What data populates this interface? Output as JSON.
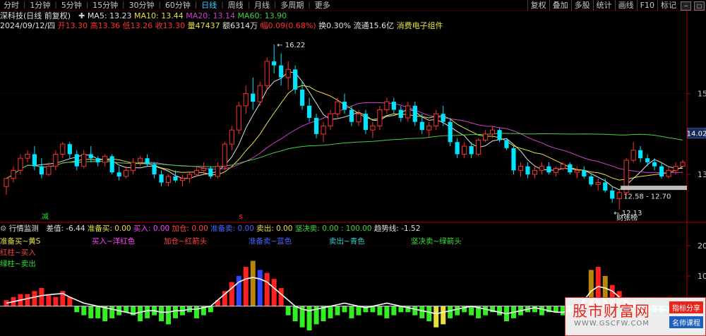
{
  "toolbar": {
    "tabs": [
      "分时",
      "1分钟",
      "5分钟",
      "15分钟",
      "30分钟",
      "60分钟",
      "日线",
      "周线",
      "月线",
      "多周期",
      "更多"
    ],
    "active_tab": 6,
    "right_tabs": [
      "复权",
      "叠加",
      "多股",
      "统计",
      "画线",
      "F10",
      "标记"
    ]
  },
  "header": {
    "stock_name": "深科技(日线 前复权)",
    "ma": [
      {
        "label": "MA5: 13.23",
        "color": "#e0e0e0"
      },
      {
        "label": "MA10: 13.44",
        "color": "#e8e040"
      },
      {
        "label": "MA20: 13.14",
        "color": "#d040d0"
      },
      {
        "label": "MA60: 13.90",
        "color": "#40d040"
      }
    ],
    "quote": {
      "date": "2024/09/12/四",
      "open_label": "开",
      "open": "13.30",
      "high_label": "高",
      "high": "13.36",
      "low_label": "低",
      "low": "13.26",
      "close_label": "收",
      "close": "13.30",
      "vol_label": "量",
      "vol": "47437",
      "amt_label": "额",
      "amt": "6314万",
      "chg_label": "幅",
      "chg": "0.09(0.68%)",
      "turn": "换0.30%",
      "float": "流通15.6亿",
      "concept": "消费电子组件"
    }
  },
  "indicator": {
    "name": "行情监测",
    "stats": [
      {
        "label": "差值: -6.44",
        "color": "#e0e0e0"
      },
      {
        "label": "准备买: 0.00",
        "color": "#e8e040"
      },
      {
        "label": "买入: 0.00",
        "color": "#ff44ff"
      },
      {
        "label": "加仓: 0.00",
        "color": "#ff4444"
      },
      {
        "label": "准备卖: 0.00",
        "color": "#4466ff"
      },
      {
        "label": "卖出: 0.00",
        "color": "#e8e040"
      },
      {
        "label": "坚决卖: 0.00 : 100.00",
        "color": "#33dd33"
      },
      {
        "label": "趋势线: -1.52",
        "color": "#e0e0e0"
      }
    ],
    "legend_row": [
      {
        "label": "买入~洋红色",
        "color": "#ff44ff"
      },
      {
        "label": "加仓~红箭头",
        "color": "#ff4444"
      },
      {
        "label": "准备卖~蓝色",
        "color": "#4466ff"
      },
      {
        "label": "卖出~青色",
        "color": "#33cccc"
      },
      {
        "label": "坚决卖~绿箭头",
        "color": "#33dd33"
      }
    ],
    "left_labels": [
      {
        "label": "准备买~黄S",
        "color": "#e8e040"
      },
      {
        "label": "红柱~买入",
        "color": "#ff4444"
      },
      {
        "label": "绿柱~卖出",
        "color": "#33dd33"
      }
    ]
  },
  "annotations": {
    "high_price": "16.22",
    "low_price": "12.13",
    "range_box": "12.58 - 12.70",
    "marker_left": "减",
    "marker_s": "s",
    "news_tag": "财张榜",
    "current_price": "14.02"
  },
  "watermark": {
    "main": "股市财富网",
    "url": "WWW.GSCFW.COM",
    "badge1": "指标分享",
    "badge2": "名师课程"
  },
  "colors": {
    "up": "#ff3030",
    "down": "#00e5ff",
    "ma5": "#e0e0e0",
    "ma10": "#e8e040",
    "ma20": "#d040d0",
    "ma60": "#40d040",
    "grid": "#7a0000",
    "axis": "#b00000"
  },
  "chart_data": [
    {
      "type": "candlestick",
      "title": "",
      "y_ticks": [
        13,
        14,
        15
      ],
      "ylim": [
        11.9,
        16.55
      ],
      "candles": [
        [
          12.7,
          12.9,
          12.5,
          12.9
        ],
        [
          12.9,
          13.2,
          12.8,
          13.1
        ],
        [
          13.1,
          13.5,
          13.0,
          13.4
        ],
        [
          13.4,
          13.6,
          13.3,
          13.5
        ],
        [
          13.5,
          13.7,
          13.1,
          13.2
        ],
        [
          13.2,
          13.4,
          12.9,
          13.0
        ],
        [
          13.0,
          13.3,
          12.95,
          13.2
        ],
        [
          13.2,
          13.6,
          13.1,
          13.5
        ],
        [
          13.5,
          13.8,
          13.4,
          13.75
        ],
        [
          13.75,
          13.8,
          13.4,
          13.5
        ],
        [
          13.5,
          13.6,
          13.1,
          13.2
        ],
        [
          13.2,
          13.6,
          13.15,
          13.5
        ],
        [
          13.5,
          13.7,
          13.3,
          13.4
        ],
        [
          13.4,
          13.45,
          13.2,
          13.3
        ],
        [
          13.3,
          13.5,
          13.2,
          13.45
        ],
        [
          13.45,
          13.5,
          13.0,
          13.05
        ],
        [
          13.05,
          13.2,
          12.85,
          12.95
        ],
        [
          12.95,
          13.2,
          12.9,
          13.1
        ],
        [
          13.1,
          13.4,
          13.0,
          13.3
        ],
        [
          13.3,
          13.45,
          13.2,
          13.4
        ],
        [
          13.4,
          13.5,
          13.2,
          13.25
        ],
        [
          13.25,
          13.3,
          12.9,
          13.0
        ],
        [
          13.0,
          13.1,
          12.7,
          12.8
        ],
        [
          12.8,
          13.0,
          12.7,
          12.95
        ],
        [
          12.95,
          13.1,
          12.8,
          12.85
        ],
        [
          12.85,
          13.0,
          12.7,
          12.9
        ],
        [
          12.9,
          13.05,
          12.8,
          13.0
        ],
        [
          13.0,
          13.2,
          12.95,
          13.1
        ],
        [
          13.1,
          13.3,
          13.0,
          13.15
        ],
        [
          13.15,
          13.2,
          12.9,
          12.95
        ],
        [
          12.95,
          13.3,
          12.9,
          13.2
        ],
        [
          13.2,
          13.8,
          13.1,
          13.75
        ],
        [
          13.75,
          14.2,
          13.6,
          14.1
        ],
        [
          14.1,
          14.8,
          14.0,
          14.7
        ],
        [
          14.7,
          15.2,
          14.5,
          15.0
        ],
        [
          15.0,
          15.4,
          14.6,
          14.8
        ],
        [
          14.8,
          15.3,
          14.7,
          15.2
        ],
        [
          15.2,
          15.9,
          15.1,
          15.8
        ],
        [
          15.8,
          16.22,
          15.5,
          15.7
        ],
        [
          15.7,
          16.0,
          15.2,
          15.4
        ],
        [
          15.4,
          15.8,
          15.1,
          15.6
        ],
        [
          15.6,
          15.7,
          15.0,
          15.1
        ],
        [
          15.1,
          15.3,
          14.6,
          14.7
        ],
        [
          14.7,
          14.9,
          14.3,
          14.4
        ],
        [
          14.4,
          14.5,
          13.9,
          14.0
        ],
        [
          14.0,
          14.3,
          13.8,
          14.2
        ],
        [
          14.2,
          14.6,
          14.1,
          14.5
        ],
        [
          14.5,
          14.9,
          14.4,
          14.8
        ],
        [
          14.8,
          15.0,
          14.5,
          14.6
        ],
        [
          14.6,
          14.7,
          14.2,
          14.3
        ],
        [
          14.3,
          14.6,
          14.2,
          14.5
        ],
        [
          14.5,
          14.6,
          14.0,
          14.1
        ],
        [
          14.1,
          14.3,
          13.9,
          14.2
        ],
        [
          14.2,
          14.7,
          14.1,
          14.6
        ],
        [
          14.6,
          14.9,
          14.5,
          14.8
        ],
        [
          14.8,
          14.9,
          14.5,
          14.6
        ],
        [
          14.6,
          14.7,
          14.3,
          14.4
        ],
        [
          14.4,
          14.8,
          14.3,
          14.7
        ],
        [
          14.7,
          14.8,
          14.2,
          14.3
        ],
        [
          14.3,
          14.5,
          14.0,
          14.1
        ],
        [
          14.1,
          14.3,
          13.9,
          14.2
        ],
        [
          14.2,
          14.6,
          14.1,
          14.5
        ],
        [
          14.5,
          14.7,
          14.2,
          14.3
        ],
        [
          14.3,
          14.4,
          13.7,
          13.8
        ],
        [
          13.8,
          13.9,
          13.4,
          13.5
        ],
        [
          13.5,
          13.8,
          13.4,
          13.7
        ],
        [
          13.7,
          13.8,
          13.4,
          13.5
        ],
        [
          13.5,
          13.9,
          13.45,
          13.85
        ],
        [
          13.85,
          14.1,
          13.8,
          14.0
        ],
        [
          14.0,
          14.2,
          13.9,
          14.1
        ],
        [
          14.1,
          14.15,
          13.8,
          13.85
        ],
        [
          13.85,
          13.9,
          13.6,
          13.65
        ],
        [
          13.65,
          13.7,
          13.0,
          13.1
        ],
        [
          13.1,
          13.3,
          12.95,
          13.2
        ],
        [
          13.2,
          13.3,
          12.9,
          13.0
        ],
        [
          13.0,
          13.2,
          12.9,
          13.1
        ],
        [
          13.1,
          13.3,
          13.0,
          13.2
        ],
        [
          13.2,
          13.3,
          13.0,
          13.05
        ],
        [
          13.05,
          13.2,
          12.95,
          13.15
        ],
        [
          13.15,
          13.3,
          13.1,
          13.25
        ],
        [
          13.25,
          13.3,
          13.0,
          13.05
        ],
        [
          13.05,
          13.2,
          12.9,
          13.1
        ],
        [
          13.1,
          13.2,
          12.9,
          12.95
        ],
        [
          12.95,
          13.0,
          12.7,
          12.75
        ],
        [
          12.75,
          12.9,
          12.6,
          12.8
        ],
        [
          12.8,
          12.9,
          12.55,
          12.6
        ],
        [
          12.6,
          12.7,
          12.3,
          12.4
        ],
        [
          12.4,
          12.6,
          12.13,
          12.55
        ],
        [
          12.55,
          13.4,
          12.5,
          13.35
        ],
        [
          13.35,
          13.8,
          13.3,
          13.6
        ],
        [
          13.6,
          13.7,
          13.3,
          13.4
        ],
        [
          13.4,
          13.5,
          13.2,
          13.3
        ],
        [
          13.3,
          13.4,
          13.1,
          13.2
        ],
        [
          13.2,
          13.3,
          12.9,
          12.95
        ],
        [
          12.95,
          13.2,
          12.9,
          13.1
        ],
        [
          13.1,
          13.3,
          13.0,
          13.2
        ],
        [
          13.2,
          13.36,
          13.26,
          13.3
        ]
      ]
    },
    {
      "type": "bar",
      "title": "行情监测",
      "y_ticks": [
        0,
        10,
        20
      ],
      "ylim": [
        -8,
        24
      ],
      "values": [
        2,
        3,
        4,
        4,
        5,
        6,
        4,
        3,
        5,
        3,
        -2,
        -3,
        -4,
        -4,
        -5,
        -4,
        -3,
        -2,
        -3,
        -5,
        -4,
        -3,
        -5,
        -6,
        -4,
        -3,
        -2,
        -4,
        -3,
        -2,
        2,
        5,
        8,
        10,
        13,
        15,
        12,
        11,
        9,
        6,
        -3,
        -5,
        -7,
        -8,
        -6,
        -5,
        -4,
        -3,
        -2,
        -4,
        -3,
        -2,
        -2,
        -3,
        -4,
        -3,
        -2,
        -2,
        -3,
        -4,
        -5,
        -7,
        -6,
        -4,
        -3,
        -2,
        -3,
        -4,
        -3,
        -2,
        -3,
        -5,
        -4,
        -3,
        -2,
        -2,
        -3,
        -2,
        -2,
        -3,
        -2,
        -1,
        2,
        12,
        13,
        10,
        7,
        5,
        3,
        2,
        -2,
        -3,
        -2,
        -2,
        -2,
        -1
      ],
      "trend_line": [
        1,
        1.5,
        2,
        2.5,
        3,
        3.5,
        3.8,
        4,
        4.2,
        3,
        2,
        1,
        0.5,
        0,
        -0.5,
        -1,
        -1.5,
        -2,
        -2.5,
        -2,
        -1.5,
        -1.5,
        -2,
        -2,
        -1.5,
        -1.5,
        -1,
        -1,
        -0.5,
        0,
        2,
        4,
        6,
        8,
        9,
        9.5,
        9,
        8,
        6,
        4,
        2,
        0,
        -1,
        -1.5,
        -1,
        -0.5,
        0,
        0.5,
        1,
        0.5,
        0,
        -0.5,
        0,
        0.5,
        1,
        0.5,
        0,
        -0.5,
        -1,
        -1.5,
        -2,
        -2.5,
        -2,
        -1.5,
        -1,
        -0.5,
        0,
        -0.5,
        -1,
        -1.5,
        -2,
        -2.5,
        -2,
        -1.5,
        -1,
        -0.5,
        -1,
        -1.5,
        -2,
        -2,
        -1.5,
        -1,
        2,
        5,
        6.5,
        6,
        5,
        3,
        1.5,
        0.5,
        -0.5,
        -1,
        -1,
        -1.2,
        -1.4,
        -1.52
      ]
    }
  ]
}
